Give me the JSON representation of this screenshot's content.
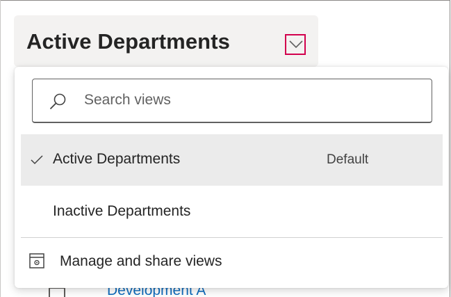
{
  "header": {
    "title": "Active Departments"
  },
  "dropdown": {
    "search_placeholder": "Search views",
    "options": [
      {
        "label": "Active Departments",
        "tag": "Default",
        "selected": true
      },
      {
        "label": "Inactive Departments",
        "selected": false
      }
    ],
    "manage_label": "Manage and share views"
  },
  "background": {
    "row_link": "Development A"
  },
  "icons": {
    "chevron": "chevron-down-icon",
    "search": "search-icon",
    "check": "checkmark-icon",
    "manage": "settings-window-icon"
  },
  "colors": {
    "highlight_border": "#d2004d",
    "selected_bg": "#ebebeb",
    "link": "#0f6cbd"
  }
}
